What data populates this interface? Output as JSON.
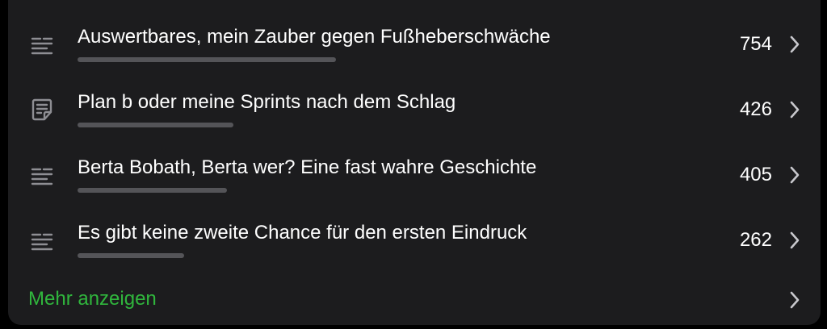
{
  "colors": {
    "background": "#1c1c1e",
    "text": "#ffffff",
    "secondary": "#8e8e93",
    "bar": "#545458",
    "accent": "#30b63d"
  },
  "items": [
    {
      "title": "Auswertbares, mein Zauber gegen Fußheberschwäche",
      "count": "754",
      "icon": "text-lines-icon"
    },
    {
      "title": "Plan b oder meine Sprints nach dem Schlag",
      "count": "426",
      "icon": "note-icon"
    },
    {
      "title": "Berta Bobath, Berta wer? Eine fast wahre Geschichte",
      "count": "405",
      "icon": "text-lines-icon"
    },
    {
      "title": "Es gibt keine zweite Chance für den ersten Eindruck",
      "count": "262",
      "icon": "text-lines-icon"
    }
  ],
  "more": {
    "label": "Mehr anzeigen"
  }
}
